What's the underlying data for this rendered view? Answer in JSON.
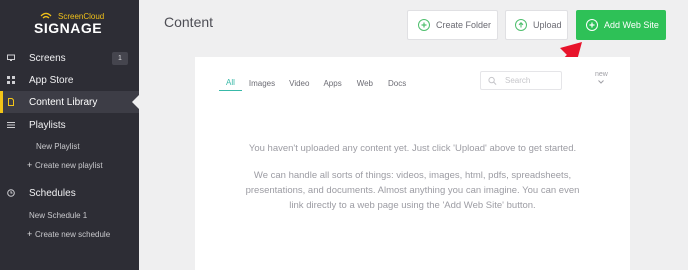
{
  "brand": {
    "top": "ScreenCloud",
    "main": "SIGNAGE"
  },
  "sidebar": {
    "items": [
      {
        "label": "Screens",
        "icon": "monitor-icon",
        "badge": "1"
      },
      {
        "label": "App Store",
        "icon": "grid-icon"
      },
      {
        "label": "Content Library",
        "icon": "file-icon",
        "active": true
      },
      {
        "label": "Playlists",
        "icon": "list-icon"
      },
      {
        "label": "Schedules",
        "icon": "clock-icon"
      }
    ],
    "playlists": {
      "item": "New Playlist",
      "create": "Create new playlist"
    },
    "schedules": {
      "item": "New Schedule 1",
      "create": "Create new schedule"
    }
  },
  "header": {
    "title": "Content",
    "buttons": {
      "create_folder": "Create Folder",
      "upload": "Upload",
      "add_web_site": "Add Web Site"
    }
  },
  "filters": {
    "tabs": [
      "All",
      "Images",
      "Video",
      "Apps",
      "Web",
      "Docs"
    ],
    "active": "All",
    "search_placeholder": "Search",
    "sort_label": "new"
  },
  "empty_state": {
    "line1": "You haven't uploaded any content yet. Just click 'Upload' above to get started.",
    "line2": "We can handle all sorts of things: videos, images, html, pdfs, spreadsheets, presentations, and documents. Almost anything you can imagine. You can even link directly to a web page using the 'Add Web Site' button."
  },
  "colors": {
    "sidebar": "#2d2d35",
    "accent": "#f2c418",
    "primary": "#2ec157",
    "tab_active": "#38b9a8",
    "arrow": "#e8132b"
  }
}
